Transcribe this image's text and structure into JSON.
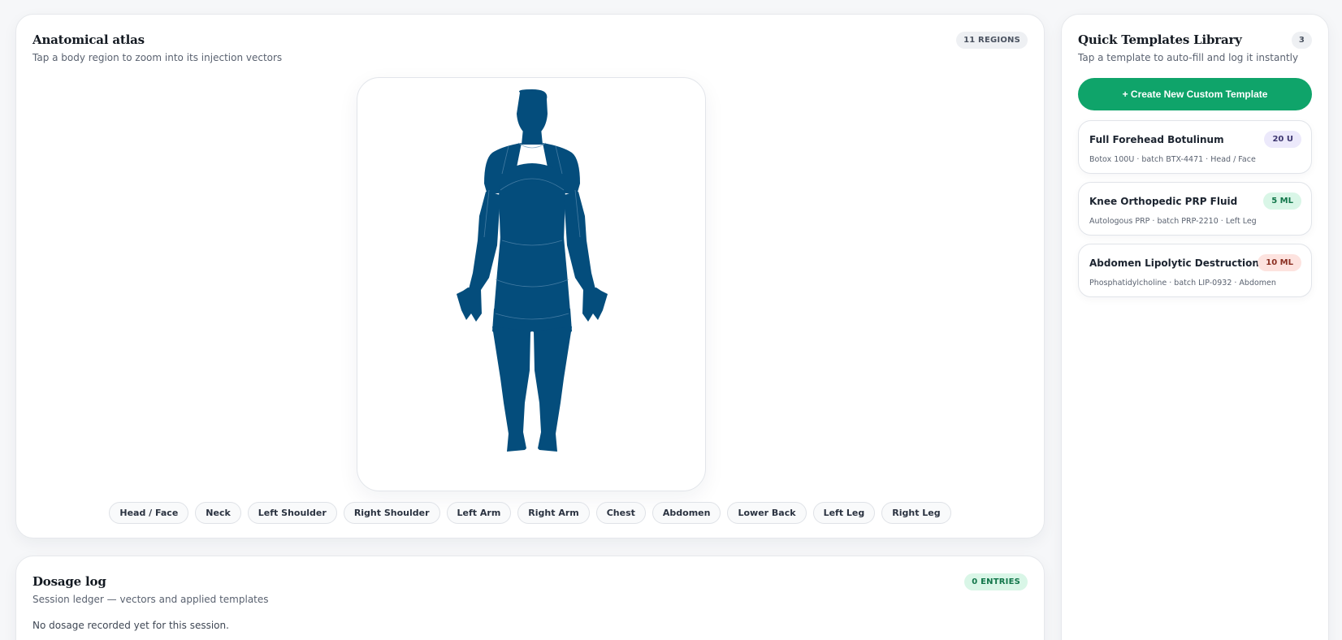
{
  "atlas": {
    "title": "Anatomical atlas",
    "subtitle": "Tap a body region to zoom into its injection vectors",
    "region_count": "11 REGIONS",
    "body_color": "#044d7c",
    "regions": [
      "Head / Face",
      "Neck",
      "Left Shoulder",
      "Right Shoulder",
      "Left Arm",
      "Right Arm",
      "Chest",
      "Abdomen",
      "Lower Back",
      "Left Leg",
      "Right Leg"
    ]
  },
  "dosage": {
    "title": "Dosage log",
    "subtitle": "Session ledger — vectors and applied templates",
    "entry_count": "0 ENTRIES",
    "empty_message": "No dosage recorded yet for this session."
  },
  "templates": {
    "title": "Quick Templates Library",
    "subtitle": "Tap a template to auto-fill and log it instantly",
    "count": "3",
    "create_label": "+ Create New Custom Template",
    "accent": "#0fa46a",
    "items": [
      {
        "name": "Full Forehead Botulinum",
        "meta": "Botox 100U · batch BTX-4471 · Head / Face",
        "dose": "20 U",
        "dose_bg": "#ece9fb",
        "dose_fg": "#3d3670"
      },
      {
        "name": "Knee Orthopedic PRP Fluid",
        "meta": "Autologous PRP · batch PRP-2210 · Left Leg",
        "dose": "5 ML",
        "dose_bg": "#d9f6e7",
        "dose_fg": "#12764a"
      },
      {
        "name": "Abdomen Lipolytic Destruction",
        "meta": "Phosphatidylcholine · batch LIP-0932 · Abdomen",
        "dose": "10 ML",
        "dose_bg": "#fde3df",
        "dose_fg": "#8a2f22"
      }
    ]
  }
}
